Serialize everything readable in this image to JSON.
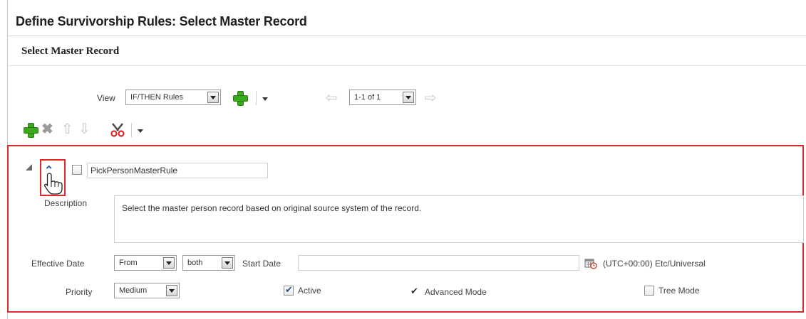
{
  "page": {
    "title": "Define Survivorship Rules: Select Master Record",
    "section_title": "Select Master Record"
  },
  "view_bar": {
    "view_label": "View",
    "view_select": "IF/THEN Rules",
    "pager_select": "1-1 of 1"
  },
  "toolbar": {
    "icons": [
      "add-icon",
      "delete-icon",
      "move-up-icon",
      "move-down-icon",
      "cut-icon",
      "dropdown-icon"
    ]
  },
  "rule": {
    "name": "PickPersonMasterRule",
    "description_label": "Description",
    "description": "Select the master person record based on original source system of the record.",
    "effective_date_label": "Effective Date",
    "effective_from": "From",
    "effective_scope": "both",
    "start_date_label": "Start Date",
    "start_date": "",
    "timezone": "(UTC+00:00) Etc/Universal",
    "priority_label": "Priority",
    "priority": "Medium",
    "active_label": "Active",
    "active_checked": true,
    "advanced_mode_label": "Advanced Mode",
    "tree_mode_label": "Tree Mode",
    "tree_mode_checked": false
  },
  "colors": {
    "highlight": "#e0282a",
    "add_green": "#3aa91d",
    "link_blue": "#2d5fb0"
  }
}
